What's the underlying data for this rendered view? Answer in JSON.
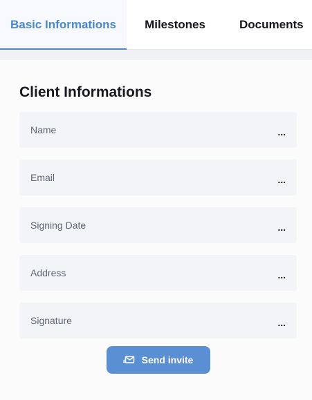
{
  "tabs": [
    {
      "label": "Basic Informations",
      "active": true
    },
    {
      "label": "Milestones",
      "active": false
    },
    {
      "label": "Documents",
      "active": false
    }
  ],
  "section": {
    "title": "Client Informations"
  },
  "fields": [
    {
      "label": "Name",
      "value": "..."
    },
    {
      "label": "Email",
      "value": "..."
    },
    {
      "label": "Signing Date",
      "value": "..."
    },
    {
      "label": "Address",
      "value": "..."
    },
    {
      "label": "Signature",
      "value": "..."
    }
  ],
  "actions": {
    "send_label": "Send invite",
    "send_icon": "send-mail-icon"
  },
  "colors": {
    "accent": "#4a88cd",
    "button": "#5a8fd4"
  }
}
